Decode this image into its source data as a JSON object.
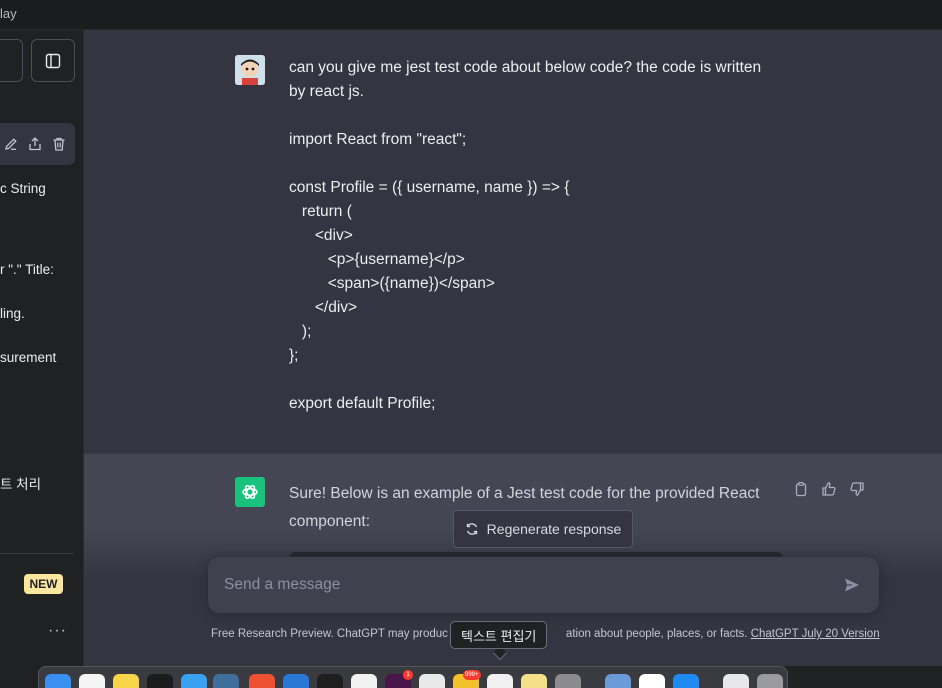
{
  "window": {
    "title": "lay"
  },
  "sidebar": {
    "toggle_icon": "sidebar-toggle-icon",
    "active_chat_actions": [
      "edit-icon",
      "share-icon",
      "trash-icon"
    ],
    "items": [
      {
        "label": "c String"
      },
      {
        "label": "r \".\" Title:"
      },
      {
        "label": "ling."
      },
      {
        "label": "surement"
      },
      {
        "label": "트 처리"
      }
    ],
    "new_badge": "NEW",
    "more": "···"
  },
  "conversation": {
    "user_message": {
      "lines": [
        "can you give me jest test code about below code? the code is written",
        "by react js.",
        "",
        "import React from \"react\";",
        "",
        "const Profile = ({ username, name }) => {",
        "   return (",
        "      <div>",
        "         <p>{username}</p>",
        "         <span>({name})</span>",
        "      </div>",
        "   );",
        "};",
        "",
        "export default Profile;"
      ]
    },
    "assistant_message": {
      "text": "Sure! Below is an example of a Jest test code for the provided React component:",
      "action_icons": [
        "clipboard-icon",
        "thumbs-up-icon",
        "thumbs-down-icon"
      ]
    }
  },
  "regenerate_button": {
    "label": "Regenerate response"
  },
  "composer": {
    "placeholder": "Send a message"
  },
  "footer": {
    "text_before": "Free Research Preview. ChatGPT may produc",
    "text_after": "ation about people, places, or facts. ",
    "link": "ChatGPT July 20 Version"
  },
  "tooltip": {
    "text": "텍스트 편집기"
  },
  "dock": {
    "badges": [
      "1",
      "999+"
    ]
  },
  "colors": {
    "accent_green": "#19c37d",
    "new_badge_bg": "#fae69e",
    "main_bg": "#343541",
    "assistant_bg": "#444654",
    "sidebar_bg": "#202123"
  }
}
